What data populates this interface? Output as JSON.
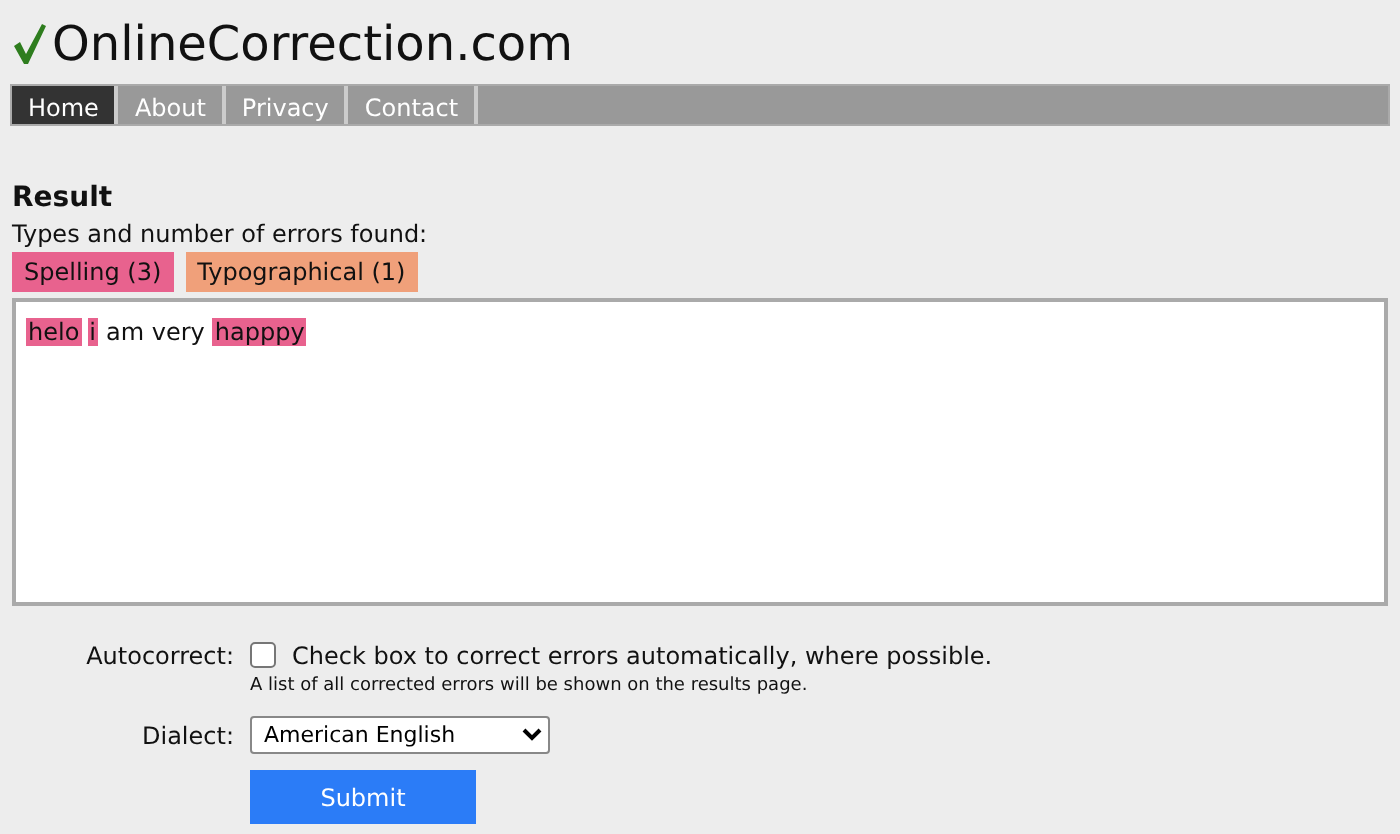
{
  "logo": {
    "text": "OnlineCorrection.com"
  },
  "nav": [
    {
      "label": "Home",
      "selected": true
    },
    {
      "label": "About",
      "selected": false
    },
    {
      "label": "Privacy",
      "selected": false
    },
    {
      "label": "Contact",
      "selected": false
    }
  ],
  "result": {
    "heading": "Result",
    "summary": "Types and number of errors found:",
    "error_types": [
      {
        "label": "Spelling (3)",
        "color": "#e8628e"
      },
      {
        "label": "Typographical (1)",
        "color": "#f0a07a"
      }
    ],
    "text": [
      {
        "text": "helo",
        "error": true
      },
      {
        "text": "i",
        "error": true
      },
      {
        "text": "am very",
        "error": false
      },
      {
        "text": "happpy",
        "error": true
      }
    ]
  },
  "form": {
    "autocorrect": {
      "label": "Autocorrect:",
      "checked": false,
      "text": "Check box to correct errors automatically, where possible.",
      "note": "A list of all corrected errors will be shown on the results page."
    },
    "dialect": {
      "label": "Dialect:",
      "value": "American English"
    },
    "submit": "Submit"
  }
}
